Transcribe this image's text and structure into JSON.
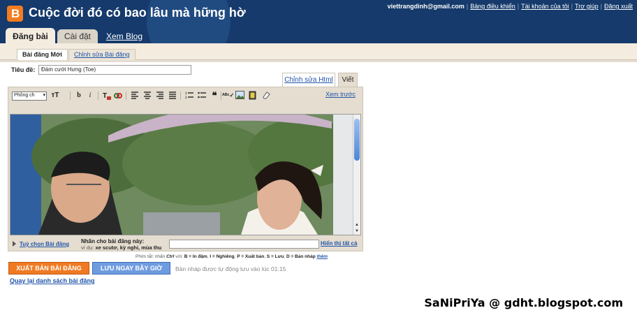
{
  "header": {
    "blog_title": "Cuộc đời đó có bao lâu mà hững hờ",
    "email": "viettrangdinh@gmail.com",
    "links": [
      "Bảng điều khiển",
      "Tài khoản của tôi",
      "Trợ giúp",
      "Đăng xuất"
    ],
    "tabs": {
      "post": "Đăng bài",
      "settings": "Cài đặt",
      "view": "Xem Blog"
    }
  },
  "subtabs": {
    "new_post": "Bài đăng Mới",
    "edit_posts": "Chỉnh sửa Bài đăng"
  },
  "post": {
    "title_label": "Tiêu đề:",
    "title_value": "Đám cưới Hưng (Toe)"
  },
  "editor": {
    "mode_html": "Chỉnh sửa Html",
    "mode_compose": "Viết",
    "font_select": "Phông ch",
    "preview_link": "Xem trước",
    "options_link": "Tuỳ chọn Bài đăng",
    "labels_title": "Nhãn cho bài đăng này:",
    "labels_hint_prefix": "ví dụ:",
    "labels_hint_examples": "xe scutơ, kỳ nghỉ, mùa thu",
    "show_all": "Hiển thị tất cả"
  },
  "shortcuts": {
    "prefix": "Phím tắt: nhấn",
    "ctrl": "Ctrl",
    "with": "với:",
    "items": [
      "B = In đậm",
      "I = Nghiêng",
      "P = Xuất bản",
      "S = Lưu",
      "D = Bản nháp"
    ],
    "more": "thêm"
  },
  "actions": {
    "publish": "XUẤT BẢN BÀI ĐĂNG",
    "save_now": "LƯU NGAY BÂY GIỜ",
    "autosave_status": "Bản nháp được tự động lưu vào lúc 01:15",
    "back_link": "Quay lại danh sách bài đăng"
  },
  "watermark": "SaNiPriYa @ gdht.blogspot.com",
  "colors": {
    "header_bg": "#153a6b",
    "publish": "#f07a22",
    "save": "#6f9ce0",
    "link": "#2255aa"
  }
}
